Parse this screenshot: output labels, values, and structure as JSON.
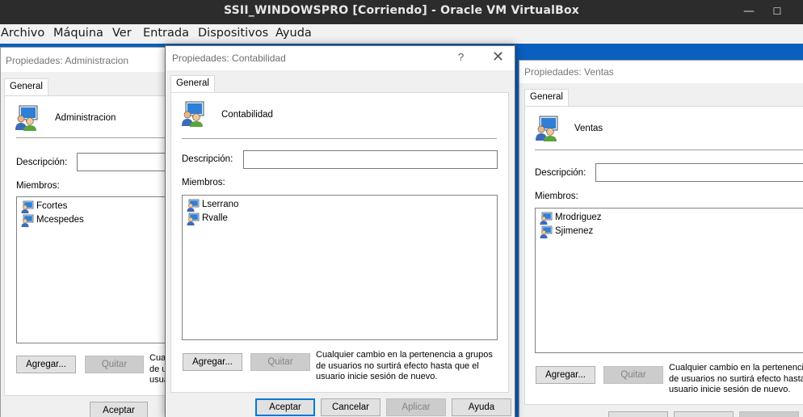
{
  "vbox": {
    "title": "SSII_WINDOWSPRO [Corriendo] - Oracle VM VirtualBox",
    "menu": [
      "Archivo",
      "Máquina",
      "Ver",
      "Entrada",
      "Dispositivos",
      "Ayuda"
    ],
    "minimize_glyph": "—",
    "maximize_glyph": "☐"
  },
  "dialogs": {
    "administracion": {
      "title": "Propiedades: Administracion",
      "tab": "General",
      "group_name": "Administracion",
      "description_label": "Descripción:",
      "description_value": "",
      "members_label": "Miembros:",
      "members": [
        "Fcortes",
        "Mcespedes"
      ],
      "add_button": "Agregar...",
      "remove_button": "Quitar",
      "note_lines": [
        "Cua",
        "de u",
        "usua"
      ],
      "ok_button": "Aceptar"
    },
    "contabilidad": {
      "title": "Propiedades: Contabilidad",
      "help_glyph": "?",
      "close_glyph": "✕",
      "tab": "General",
      "group_name": "Contabilidad",
      "description_label": "Descripción:",
      "description_value": "",
      "members_label": "Miembros:",
      "members": [
        "Lserrano",
        "Rvalle"
      ],
      "add_button": "Agregar...",
      "remove_button": "Quitar",
      "note_lines": [
        "Cualquier cambio en la pertenencia a grupos",
        "de usuarios no surtirá efecto hasta que el",
        "usuario inicie sesión de nuevo."
      ],
      "ok_button": "Aceptar",
      "cancel_button": "Cancelar",
      "apply_button": "Aplicar",
      "help_button": "Ayuda"
    },
    "ventas": {
      "title": "Propiedades: Ventas",
      "tab": "General",
      "group_name": "Ventas",
      "description_label": "Descripción:",
      "description_value": "",
      "members_label": "Miembros:",
      "members": [
        "Mrodriguez",
        "Sjimenez"
      ],
      "add_button": "Agregar...",
      "remove_button": "Quitar",
      "note_lines": [
        "Cualquier cambio en la pertenencia",
        "de usuarios no surtirá efecto hasta",
        "usuario inicie sesión de nuevo."
      ]
    }
  },
  "icons": {
    "group": "group-users-icon",
    "user": "user-icon"
  }
}
